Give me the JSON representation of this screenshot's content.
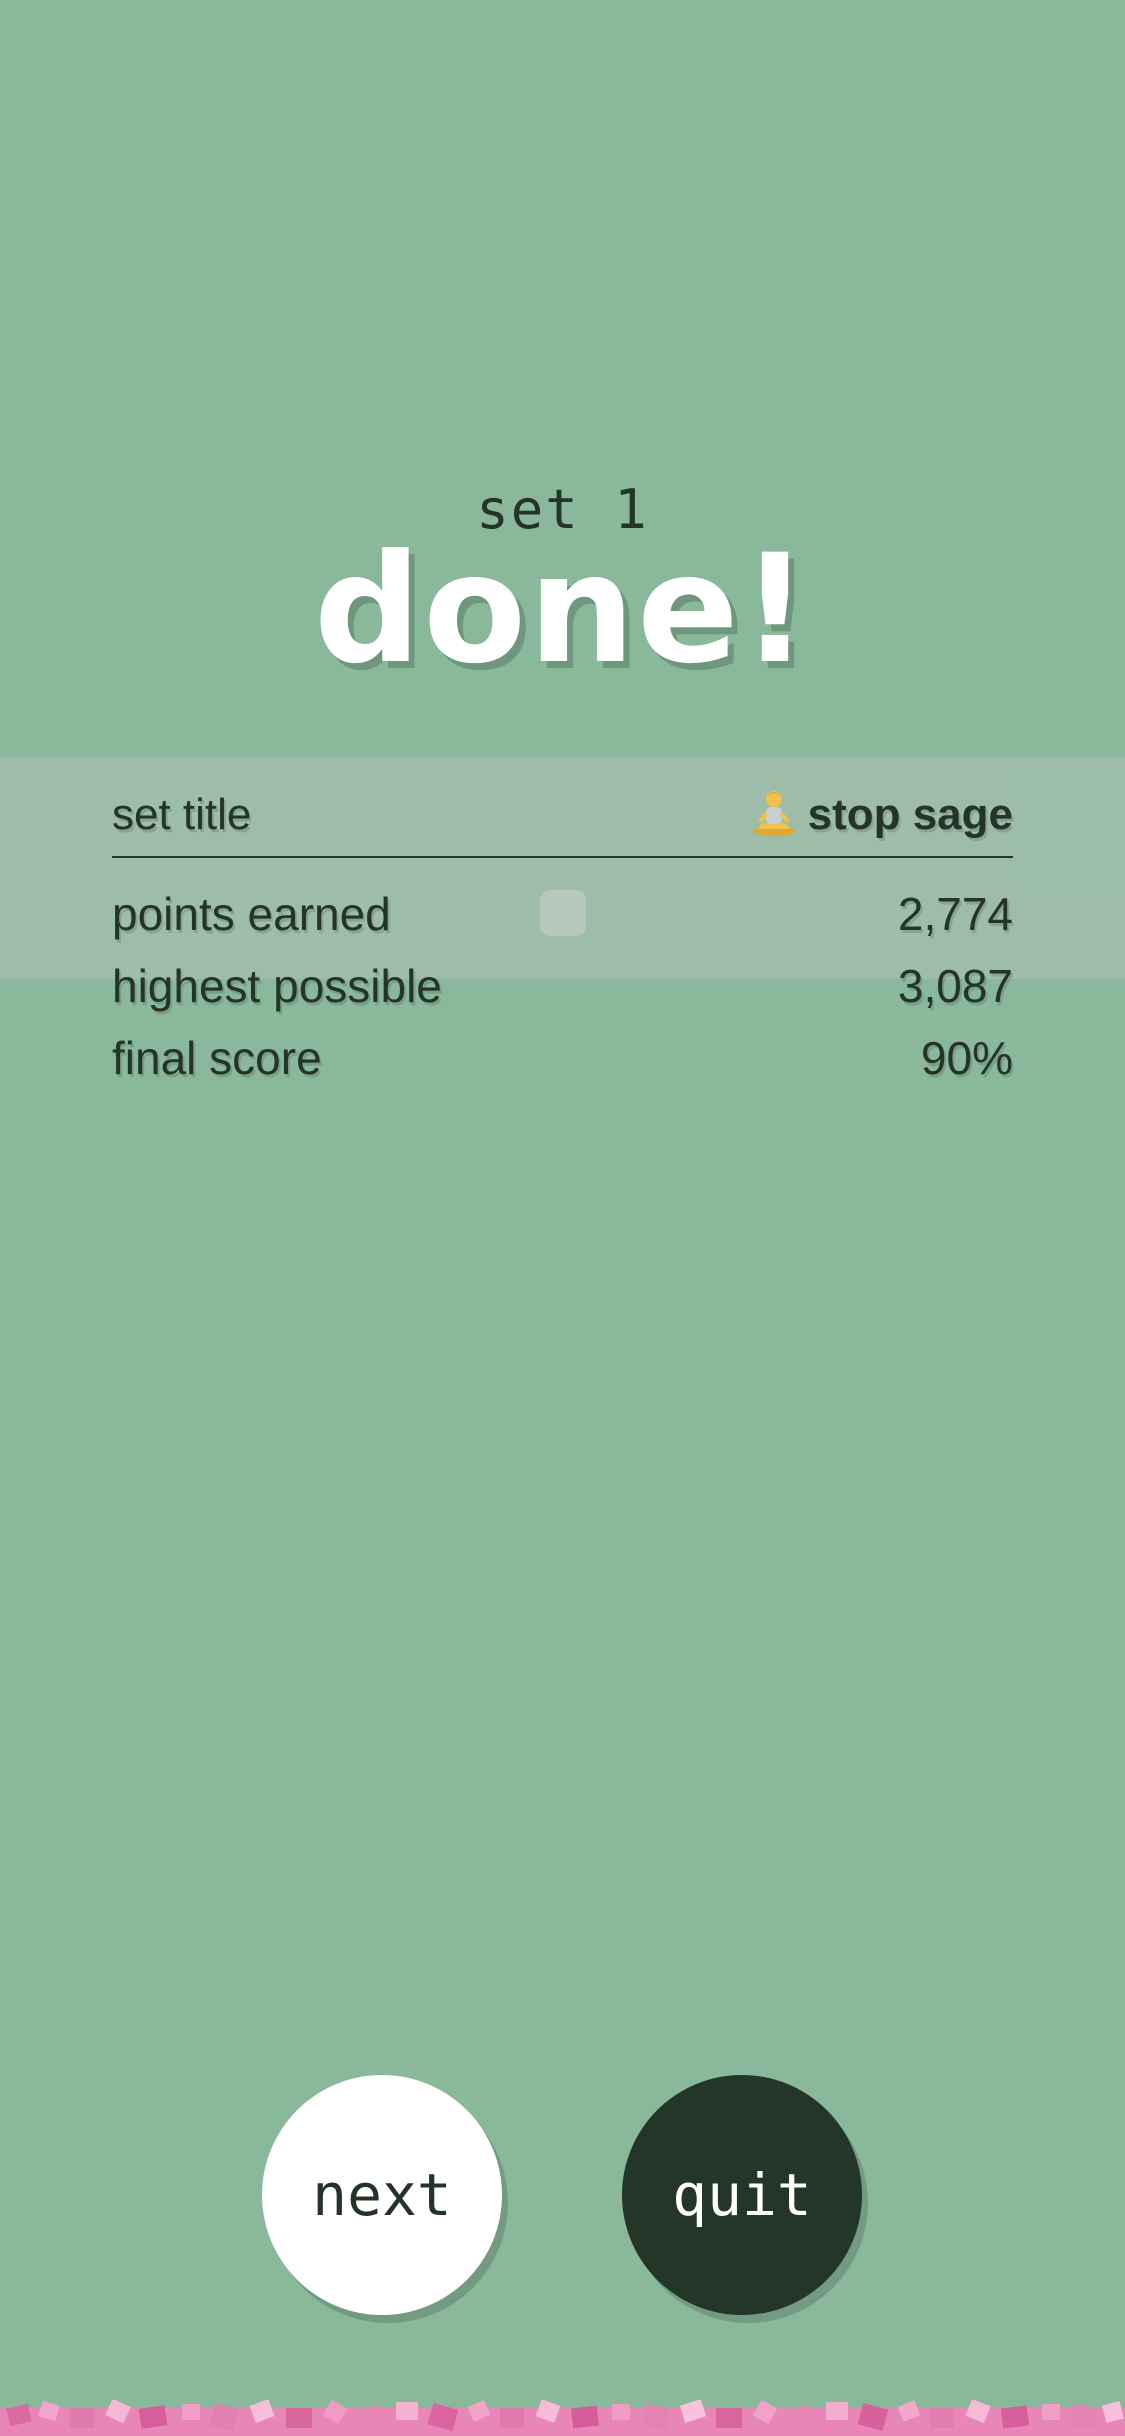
{
  "header": {
    "set_label": "set 1",
    "title": "done!"
  },
  "stats": {
    "head": {
      "label": "set title",
      "value": "stop sage",
      "icon": "person-in-lotus-position-icon"
    },
    "rows": [
      {
        "label": "points earned",
        "value": "2,774"
      },
      {
        "label": "highest possible",
        "value": "3,087"
      },
      {
        "label": "final score",
        "value": "90%"
      }
    ]
  },
  "buttons": {
    "next_label": "next",
    "quit_label": "quit"
  },
  "colors": {
    "background": "#89b99a",
    "dark": "#253428",
    "title": "#ffffff",
    "confetti": "#e986b8"
  }
}
